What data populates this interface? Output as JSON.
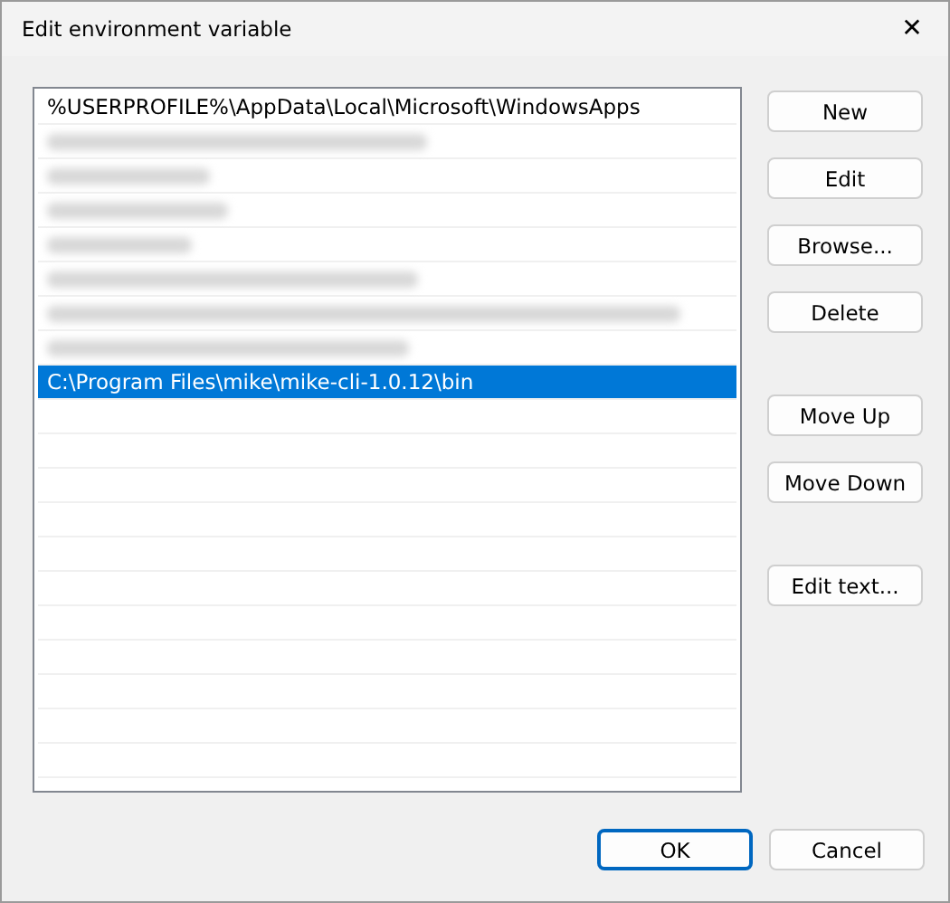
{
  "window": {
    "title": "Edit environment variable",
    "close": "✕"
  },
  "list": {
    "rows": [
      {
        "kind": "text",
        "text": "%USERPROFILE%\\AppData\\Local\\Microsoft\\WindowsApps",
        "selected": false
      },
      {
        "kind": "redacted",
        "selected": false
      },
      {
        "kind": "redacted",
        "selected": false
      },
      {
        "kind": "redacted",
        "selected": false
      },
      {
        "kind": "redacted",
        "selected": false
      },
      {
        "kind": "redacted",
        "selected": false
      },
      {
        "kind": "redacted",
        "selected": false
      },
      {
        "kind": "redacted",
        "selected": false
      },
      {
        "kind": "text",
        "text": "C:\\Program Files\\mike\\mike-cli-1.0.12\\bin",
        "selected": true
      }
    ]
  },
  "side_buttons": [
    [
      "New",
      "Edit",
      "Browse...",
      "Delete"
    ],
    [
      "Move Up",
      "Move Down"
    ],
    [
      "Edit text..."
    ]
  ],
  "footer_buttons": [
    {
      "label": "OK",
      "default": true
    },
    {
      "label": "Cancel",
      "default": false
    }
  ]
}
